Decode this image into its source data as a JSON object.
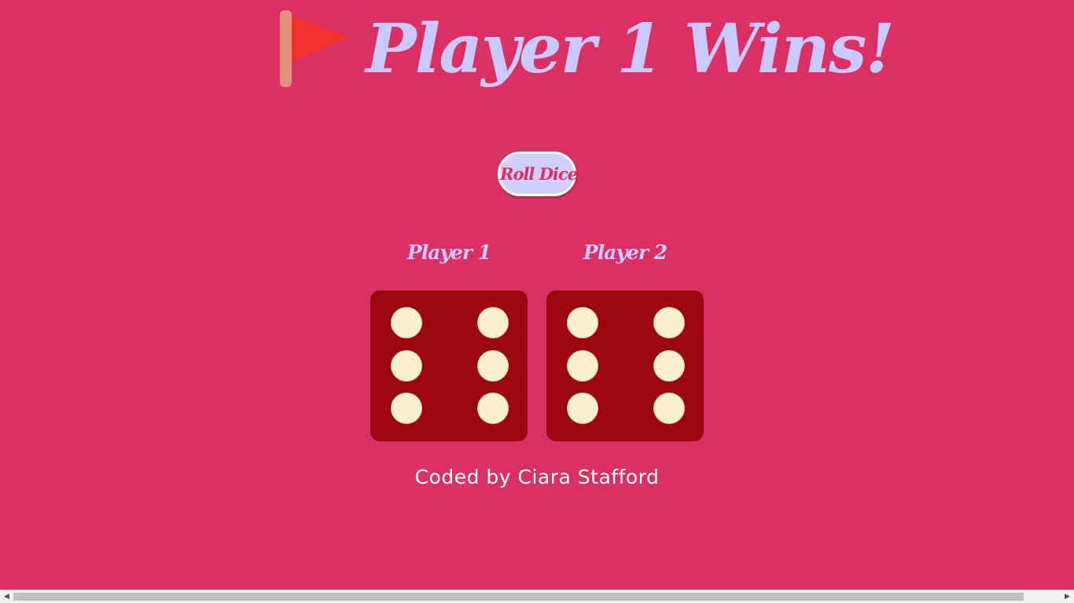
{
  "header": {
    "flag_icon": "red-flag-icon",
    "title": "Player 1 Wins!"
  },
  "controls": {
    "roll_label": "Roll Dice"
  },
  "players": [
    {
      "label": "Player 1",
      "die_value": 6
    },
    {
      "label": "Player 2",
      "die_value": 6
    }
  ],
  "footer": {
    "credit": "Coded by Ciara Stafford"
  },
  "colors": {
    "background": "#db3063",
    "title": "#c9c8ff",
    "button_bg": "#cfd0ff",
    "die": "#9b070d",
    "pip": "#fbefd0",
    "flag": "#f3322f",
    "flag_pole": "#e5907a"
  }
}
